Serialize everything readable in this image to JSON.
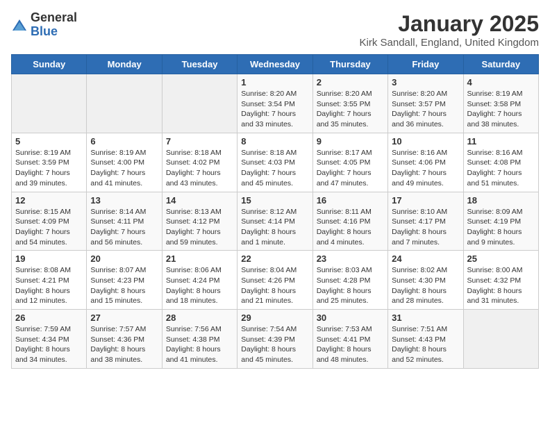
{
  "header": {
    "logo_general": "General",
    "logo_blue": "Blue",
    "month": "January 2025",
    "location": "Kirk Sandall, England, United Kingdom"
  },
  "weekdays": [
    "Sunday",
    "Monday",
    "Tuesday",
    "Wednesday",
    "Thursday",
    "Friday",
    "Saturday"
  ],
  "weeks": [
    [
      {
        "day": "",
        "info": ""
      },
      {
        "day": "",
        "info": ""
      },
      {
        "day": "",
        "info": ""
      },
      {
        "day": "1",
        "info": "Sunrise: 8:20 AM\nSunset: 3:54 PM\nDaylight: 7 hours\nand 33 minutes."
      },
      {
        "day": "2",
        "info": "Sunrise: 8:20 AM\nSunset: 3:55 PM\nDaylight: 7 hours\nand 35 minutes."
      },
      {
        "day": "3",
        "info": "Sunrise: 8:20 AM\nSunset: 3:57 PM\nDaylight: 7 hours\nand 36 minutes."
      },
      {
        "day": "4",
        "info": "Sunrise: 8:19 AM\nSunset: 3:58 PM\nDaylight: 7 hours\nand 38 minutes."
      }
    ],
    [
      {
        "day": "5",
        "info": "Sunrise: 8:19 AM\nSunset: 3:59 PM\nDaylight: 7 hours\nand 39 minutes."
      },
      {
        "day": "6",
        "info": "Sunrise: 8:19 AM\nSunset: 4:00 PM\nDaylight: 7 hours\nand 41 minutes."
      },
      {
        "day": "7",
        "info": "Sunrise: 8:18 AM\nSunset: 4:02 PM\nDaylight: 7 hours\nand 43 minutes."
      },
      {
        "day": "8",
        "info": "Sunrise: 8:18 AM\nSunset: 4:03 PM\nDaylight: 7 hours\nand 45 minutes."
      },
      {
        "day": "9",
        "info": "Sunrise: 8:17 AM\nSunset: 4:05 PM\nDaylight: 7 hours\nand 47 minutes."
      },
      {
        "day": "10",
        "info": "Sunrise: 8:16 AM\nSunset: 4:06 PM\nDaylight: 7 hours\nand 49 minutes."
      },
      {
        "day": "11",
        "info": "Sunrise: 8:16 AM\nSunset: 4:08 PM\nDaylight: 7 hours\nand 51 minutes."
      }
    ],
    [
      {
        "day": "12",
        "info": "Sunrise: 8:15 AM\nSunset: 4:09 PM\nDaylight: 7 hours\nand 54 minutes."
      },
      {
        "day": "13",
        "info": "Sunrise: 8:14 AM\nSunset: 4:11 PM\nDaylight: 7 hours\nand 56 minutes."
      },
      {
        "day": "14",
        "info": "Sunrise: 8:13 AM\nSunset: 4:12 PM\nDaylight: 7 hours\nand 59 minutes."
      },
      {
        "day": "15",
        "info": "Sunrise: 8:12 AM\nSunset: 4:14 PM\nDaylight: 8 hours\nand 1 minute."
      },
      {
        "day": "16",
        "info": "Sunrise: 8:11 AM\nSunset: 4:16 PM\nDaylight: 8 hours\nand 4 minutes."
      },
      {
        "day": "17",
        "info": "Sunrise: 8:10 AM\nSunset: 4:17 PM\nDaylight: 8 hours\nand 7 minutes."
      },
      {
        "day": "18",
        "info": "Sunrise: 8:09 AM\nSunset: 4:19 PM\nDaylight: 8 hours\nand 9 minutes."
      }
    ],
    [
      {
        "day": "19",
        "info": "Sunrise: 8:08 AM\nSunset: 4:21 PM\nDaylight: 8 hours\nand 12 minutes."
      },
      {
        "day": "20",
        "info": "Sunrise: 8:07 AM\nSunset: 4:23 PM\nDaylight: 8 hours\nand 15 minutes."
      },
      {
        "day": "21",
        "info": "Sunrise: 8:06 AM\nSunset: 4:24 PM\nDaylight: 8 hours\nand 18 minutes."
      },
      {
        "day": "22",
        "info": "Sunrise: 8:04 AM\nSunset: 4:26 PM\nDaylight: 8 hours\nand 21 minutes."
      },
      {
        "day": "23",
        "info": "Sunrise: 8:03 AM\nSunset: 4:28 PM\nDaylight: 8 hours\nand 25 minutes."
      },
      {
        "day": "24",
        "info": "Sunrise: 8:02 AM\nSunset: 4:30 PM\nDaylight: 8 hours\nand 28 minutes."
      },
      {
        "day": "25",
        "info": "Sunrise: 8:00 AM\nSunset: 4:32 PM\nDaylight: 8 hours\nand 31 minutes."
      }
    ],
    [
      {
        "day": "26",
        "info": "Sunrise: 7:59 AM\nSunset: 4:34 PM\nDaylight: 8 hours\nand 34 minutes."
      },
      {
        "day": "27",
        "info": "Sunrise: 7:57 AM\nSunset: 4:36 PM\nDaylight: 8 hours\nand 38 minutes."
      },
      {
        "day": "28",
        "info": "Sunrise: 7:56 AM\nSunset: 4:38 PM\nDaylight: 8 hours\nand 41 minutes."
      },
      {
        "day": "29",
        "info": "Sunrise: 7:54 AM\nSunset: 4:39 PM\nDaylight: 8 hours\nand 45 minutes."
      },
      {
        "day": "30",
        "info": "Sunrise: 7:53 AM\nSunset: 4:41 PM\nDaylight: 8 hours\nand 48 minutes."
      },
      {
        "day": "31",
        "info": "Sunrise: 7:51 AM\nSunset: 4:43 PM\nDaylight: 8 hours\nand 52 minutes."
      },
      {
        "day": "",
        "info": ""
      }
    ]
  ]
}
